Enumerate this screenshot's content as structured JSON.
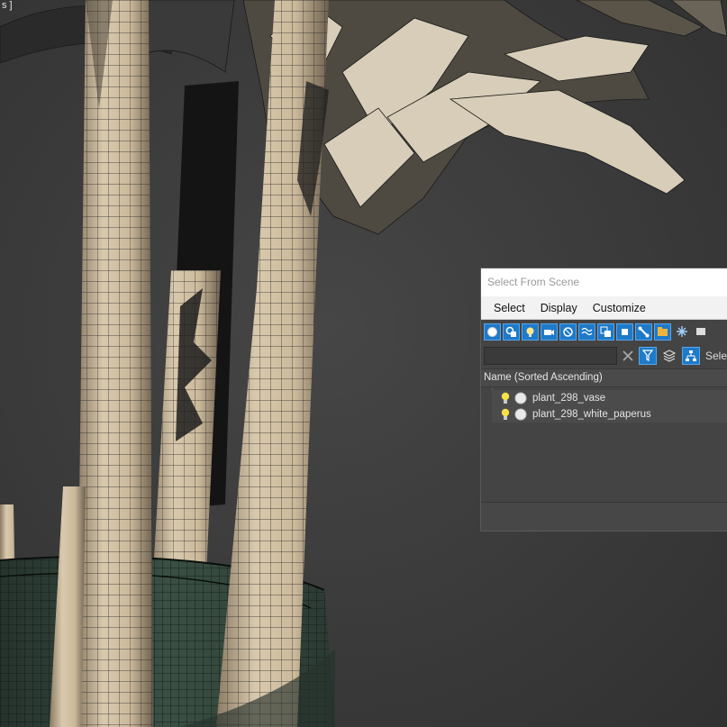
{
  "viewport": {
    "corner_label": "s ]",
    "background_color": "#3b3b3b"
  },
  "dialog": {
    "title": "Select From Scene",
    "menu": [
      "Select",
      "Display",
      "Customize"
    ],
    "toolbar_icons": [
      "display-geometry-icon",
      "display-shapes-icon",
      "display-lights-icon",
      "display-cameras-icon",
      "display-helpers-icon",
      "display-space-warps-icon",
      "display-groups-icon",
      "display-xrefs-icon",
      "display-bones-icon",
      "display-containers-icon",
      "display-frozen-icon",
      "display-hidden-icon"
    ],
    "search": {
      "value": "",
      "placeholder": ""
    },
    "select_label": "Sele",
    "column_header": "Name (Sorted Ascending)",
    "items": [
      {
        "name": "plant_298_vase"
      },
      {
        "name": "plant_298_white_paperus"
      }
    ],
    "accent_color": "#1f7ac8"
  }
}
